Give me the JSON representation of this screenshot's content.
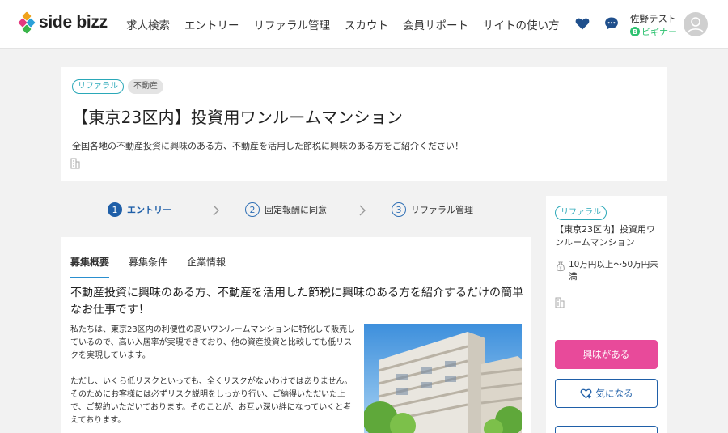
{
  "header": {
    "logo_text": "side bizz",
    "nav": [
      "求人検索",
      "エントリー",
      "リファラル管理",
      "スカウト",
      "会員サポート",
      "サイトの使い方"
    ],
    "user_name": "佐野テスト",
    "user_rank": "ビギナー",
    "rank_badge": "B",
    "icons": [
      "heart-icon",
      "chat-icon",
      "avatar-icon"
    ]
  },
  "job": {
    "tags": [
      "リファラル",
      "不動産"
    ],
    "title": "【東京23区内】投資用ワンルームマンション",
    "lead": "全国各地の不動産投資に興味のある方、不動産を活用した節税に興味のある方をご紹介ください！"
  },
  "steps": [
    {
      "num": "1",
      "label": "エントリー",
      "active": true
    },
    {
      "num": "2",
      "label": "固定報酬に同意",
      "active": false
    },
    {
      "num": "3",
      "label": "リファラル管理",
      "active": false
    }
  ],
  "tabs": [
    "募集概要",
    "募集条件",
    "企業情報"
  ],
  "content": {
    "headline": "不動産投資に興味のある方、不動産を活用した節税に興味のある方を紹介するだけの簡単なお仕事です！",
    "paragraph1": "私たちは、東京23区内の利便性の高いワンルームマンションに特化して販売しているので、高い入居率が実現できており、他の資産投資と比較しても低リスクを実現しています。",
    "paragraph2": "ただし、いくら低リスクといっても、全くリスクがないわけではありません。そのためにお客様には必ずリスク説明をしっかり行い、ご納得いただいた上で、ご契約いただいております。そのことが、お互い深い絆になっていくと考えております。"
  },
  "side": {
    "tag": "リファラル",
    "title": "【東京23区内】投資用ワンルームマンション",
    "salary": "10万円以上～50万円未満",
    "interest_button": "興味がある",
    "favorite_button": "気になる"
  },
  "colors": {
    "accent_blue": "#1f5fa8",
    "tab_underline": "#2a8fcf",
    "referral_teal": "#2aa8b8",
    "pink": "#e84a9a",
    "rank_green": "#2ec270"
  }
}
